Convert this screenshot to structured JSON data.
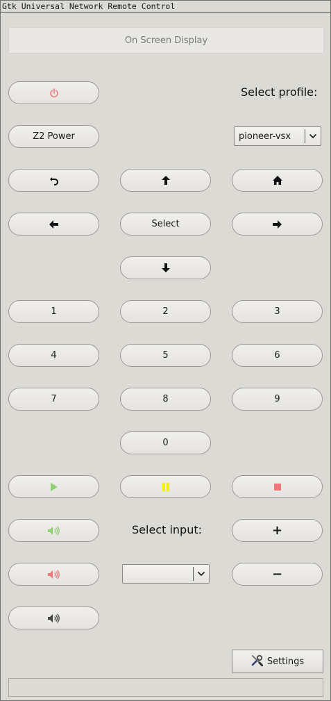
{
  "window": {
    "title": "Gtk Universal Network Remote Control"
  },
  "osd": {
    "text": "On Screen Display"
  },
  "profile": {
    "label": "Select profile:",
    "selected": "pioneer-vsx"
  },
  "buttons": {
    "power_icon": "power-icon",
    "z2_power": "Z2 Power",
    "back_icon": "undo-arrow-icon",
    "up_icon": "arrow-up-icon",
    "home_icon": "home-icon",
    "left_icon": "arrow-left-icon",
    "select": "Select",
    "right_icon": "arrow-right-icon",
    "down_icon": "arrow-down-icon"
  },
  "keypad": [
    "1",
    "2",
    "3",
    "4",
    "5",
    "6",
    "7",
    "8",
    "9",
    "0"
  ],
  "transport": {
    "play_icon": "play-icon",
    "pause_icon": "pause-icon",
    "stop_icon": "stop-icon",
    "colors": {
      "play": "#8fce73",
      "pause": "#f2f20a",
      "stop": "#f0757a",
      "power": "#f0757a"
    }
  },
  "volume": {
    "vol_up_icon": "volume-green-icon",
    "vol_down_icon": "volume-red-icon",
    "mute_icon": "volume-mute-icon",
    "plus": "+",
    "minus": "−"
  },
  "input": {
    "label": "Select input:",
    "selected": ""
  },
  "settings": {
    "label": "Settings",
    "icon": "tools-icon"
  }
}
